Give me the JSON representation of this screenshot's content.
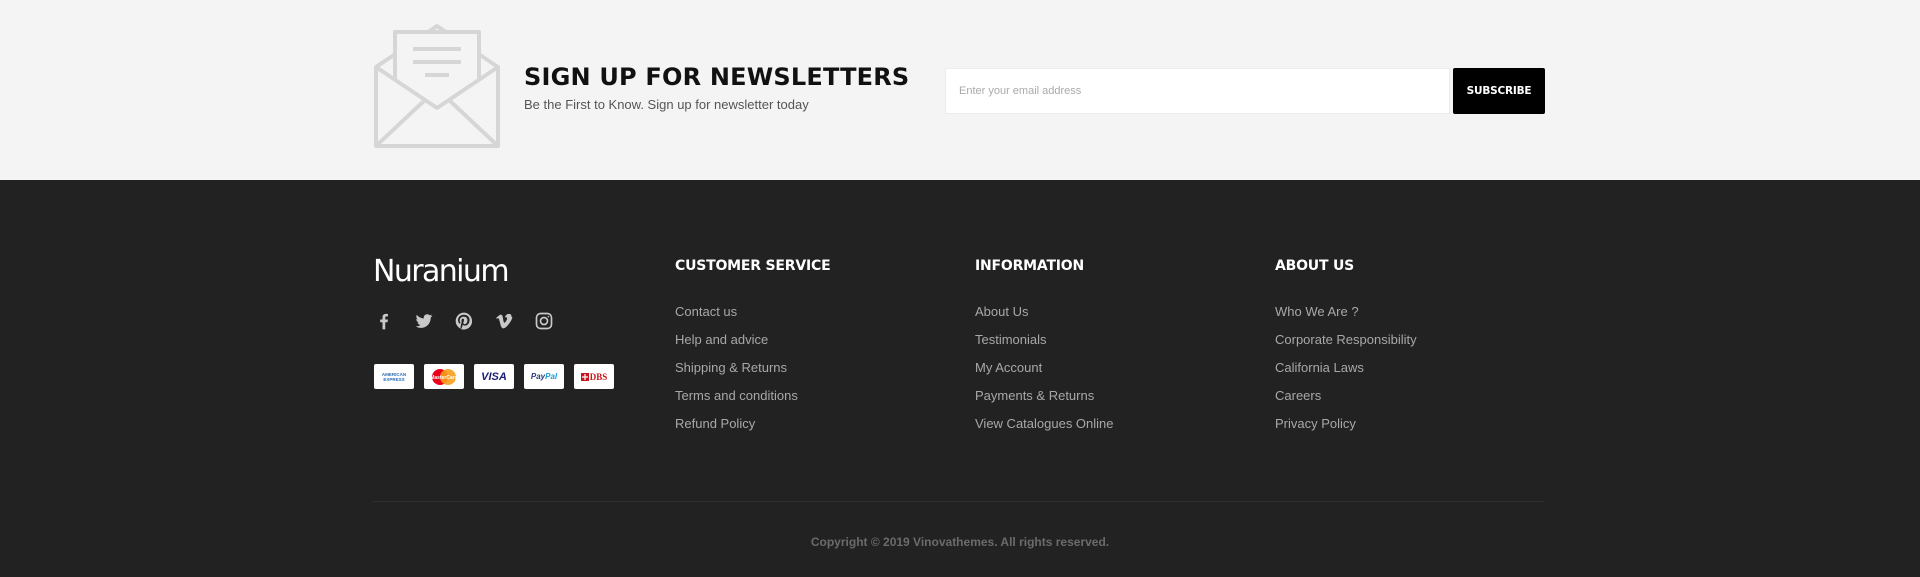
{
  "newsletter": {
    "title": "SIGN UP FOR NEWSLETTERS",
    "subtitle": "Be the First to Know. Sign up for newsletter today",
    "email_placeholder": "Enter your email address",
    "subscribe_label": "SUBSCRIBE",
    "icon": "envelope-open-icon"
  },
  "footer": {
    "brand": "Nuranium",
    "social_icons": [
      "facebook-icon",
      "twitter-icon",
      "pinterest-icon",
      "vimeo-icon",
      "instagram-icon"
    ],
    "payments": {
      "amex": "AMERICAN EXPRESS",
      "mastercard": "MasterCard",
      "visa": "VISA",
      "paypal_1": "Pay",
      "paypal_2": "Pal",
      "dbs": "DBS"
    },
    "columns": [
      {
        "title": "CUSTOMER SERVICE",
        "links": [
          "Contact us",
          "Help and advice",
          "Shipping & Returns",
          "Terms and conditions",
          "Refund Policy"
        ]
      },
      {
        "title": "INFORMATION",
        "links": [
          "About Us",
          "Testimonials",
          "My Account",
          "Payments & Returns",
          "View Catalogues Online"
        ]
      },
      {
        "title": "ABOUT US",
        "links": [
          "Who We Are ?",
          "Corporate Responsibility",
          "California Laws",
          "Careers",
          "Privacy Policy"
        ]
      }
    ],
    "copyright": "Copyright © 2019 Vinovathemes. All rights reserved."
  }
}
